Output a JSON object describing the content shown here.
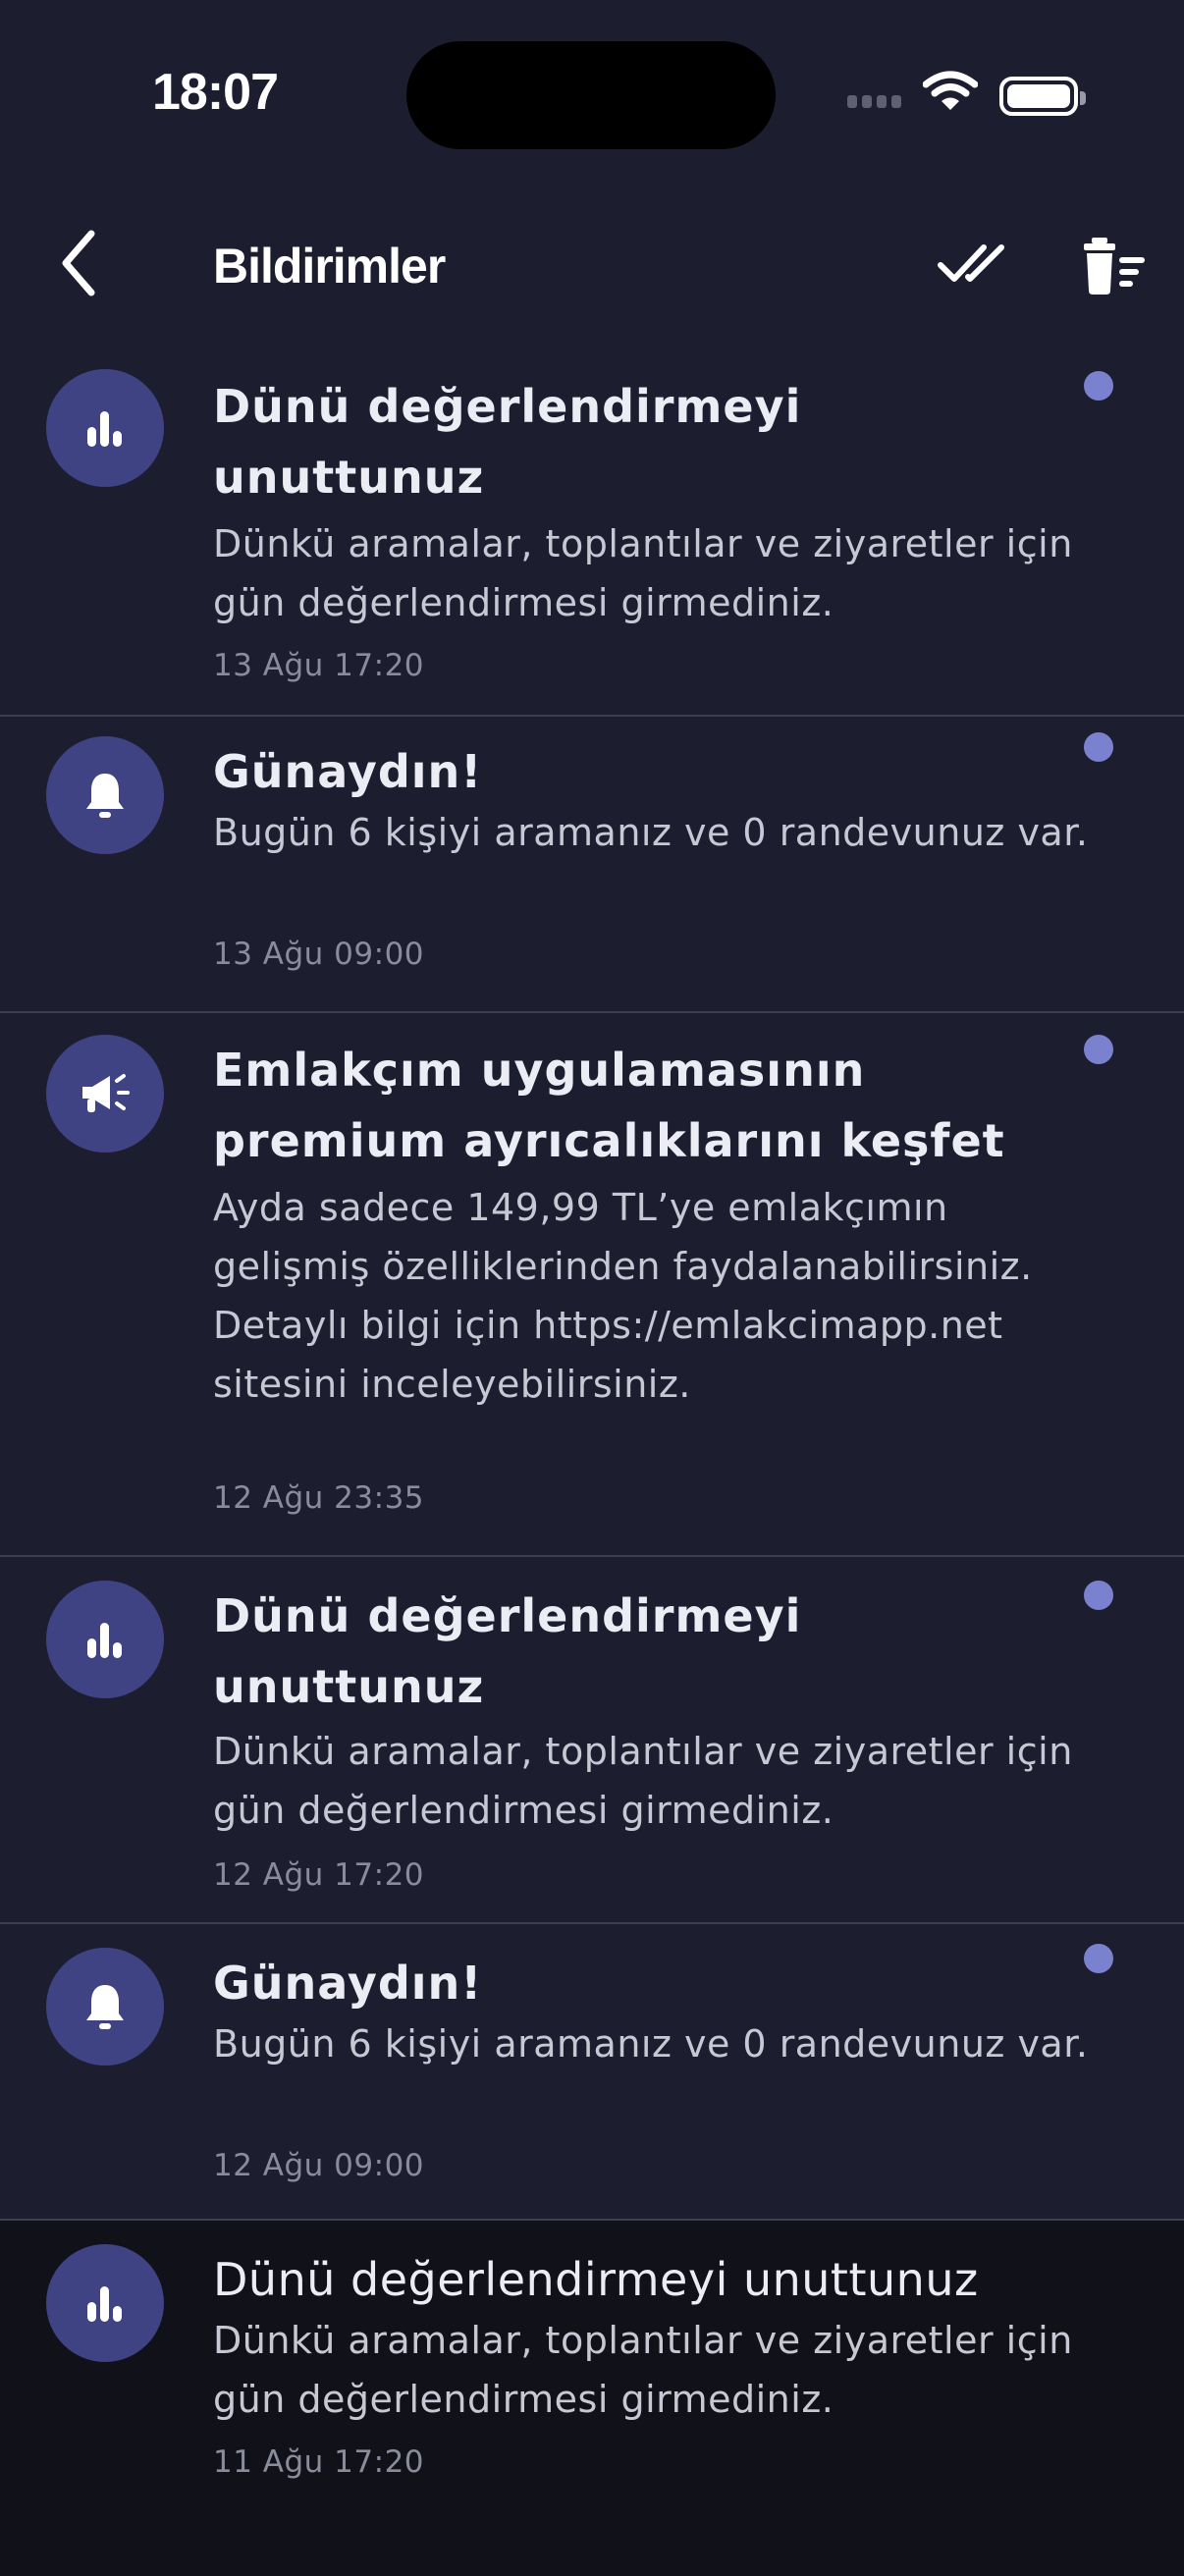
{
  "status_bar": {
    "time": "18:07"
  },
  "header": {
    "title": "Bildirimler"
  },
  "notifications": [
    {
      "icon": "bar-chart-icon",
      "title": "Dünü değerlendirmeyi unuttunuz",
      "body": "Dünkü aramalar, toplantılar ve ziyaretler için gün değerlendirmesi girmediniz.",
      "date": "13 Ağu 17:20",
      "unread": true
    },
    {
      "icon": "bell-icon",
      "title": "Günaydın!",
      "body": "Bugün 6 kişiyi aramanız ve 0 randevunuz var.",
      "date": "13 Ağu 09:00",
      "unread": true
    },
    {
      "icon": "megaphone-icon",
      "title": "Emlakçım uygulamasının premium ayrıcalıklarını keşfet",
      "body": "Ayda sadece 149,99 TL’ye emlakçımın gelişmiş özelliklerinden faydalanabilirsiniz. Detaylı bilgi için https://emlakcimapp.net sitesini inceleyebilirsiniz.",
      "date": "12 Ağu 23:35",
      "unread": true
    },
    {
      "icon": "bar-chart-icon",
      "title": "Dünü değerlendirmeyi unuttunuz",
      "body": "Dünkü aramalar, toplantılar ve ziyaretler için gün değerlendirmesi girmediniz.",
      "date": "12 Ağu 17:20",
      "unread": true
    },
    {
      "icon": "bell-icon",
      "title": "Günaydın!",
      "body": "Bugün 6 kişiyi aramanız ve 0 randevunuz var.",
      "date": "12 Ağu 09:00",
      "unread": true
    },
    {
      "icon": "bar-chart-icon",
      "title": "Dünü değerlendirmeyi unuttunuz",
      "body": "Dünkü aramalar, toplantılar ve ziyaretler için gün değerlendirmesi girmediniz.",
      "date": "11 Ağu 17:20",
      "unread": false
    }
  ],
  "colors": {
    "background": "#1c1e30",
    "read_background": "#111219",
    "avatar": "#3f4383",
    "unread_dot": "#7a82cf"
  }
}
